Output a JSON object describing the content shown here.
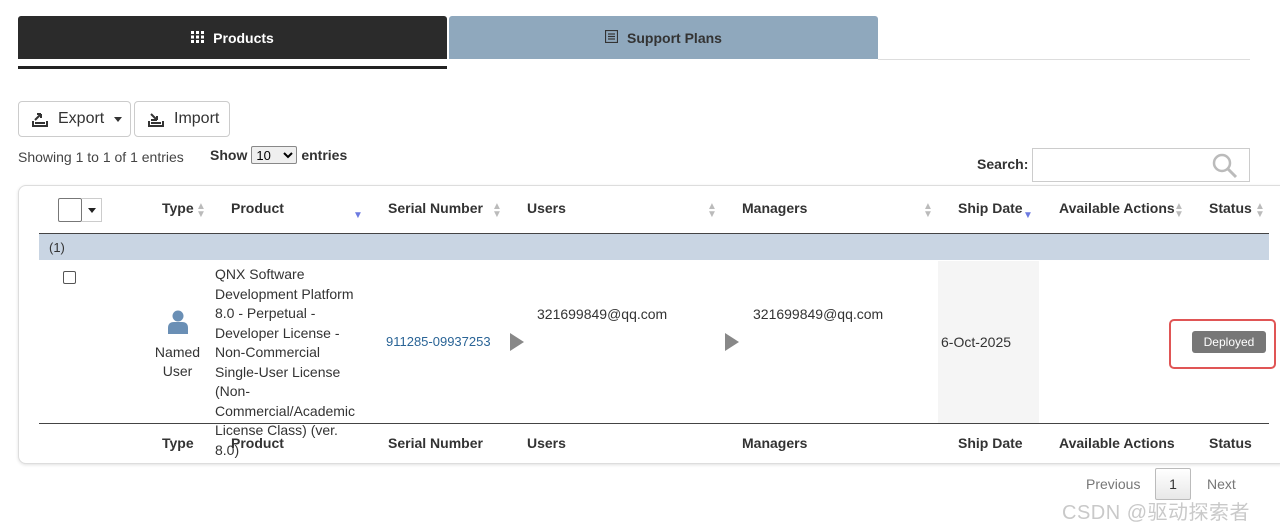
{
  "tabs": {
    "products": "Products",
    "support_plans": "Support Plans"
  },
  "toolbar": {
    "export_label": "Export",
    "import_label": "Import"
  },
  "table_info": {
    "showing": "Showing 1 to 1 of 1 entries",
    "show_prefix": "Show",
    "page_size": "10",
    "show_suffix": "entries",
    "search_label": "Search:",
    "search_value": ""
  },
  "columns": {
    "type": "Type",
    "product": "Product",
    "serial_number": "Serial Number",
    "users": "Users",
    "managers": "Managers",
    "ship_date": "Ship Date",
    "available_actions": "Available Actions",
    "status": "Status"
  },
  "group": {
    "label": "(1)"
  },
  "row": {
    "type": "Named User",
    "type_icon": "user-icon",
    "product": "QNX Software Development Platform 8.0 - Perpetual - Developer License - Non-Commercial Single-User License (Non-Commercial/Academic License Class) (ver. 8.0)",
    "serial_number": "911285-09937253",
    "users": "321699849@qq.com",
    "managers": "321699849@qq.com",
    "ship_date": "6-Oct-2025",
    "available_actions": "",
    "status": "Deployed"
  },
  "pagination": {
    "previous": "Previous",
    "current_page": "1",
    "next": "Next"
  },
  "watermark": "CSDN @驱动探索者",
  "colors": {
    "active_tab": "#2b2b2b",
    "inactive_tab": "#8fa8bd",
    "group_row": "#c9d5e3",
    "link": "#2a6496",
    "status_badge": "#777777",
    "highlight": "#e05555"
  }
}
